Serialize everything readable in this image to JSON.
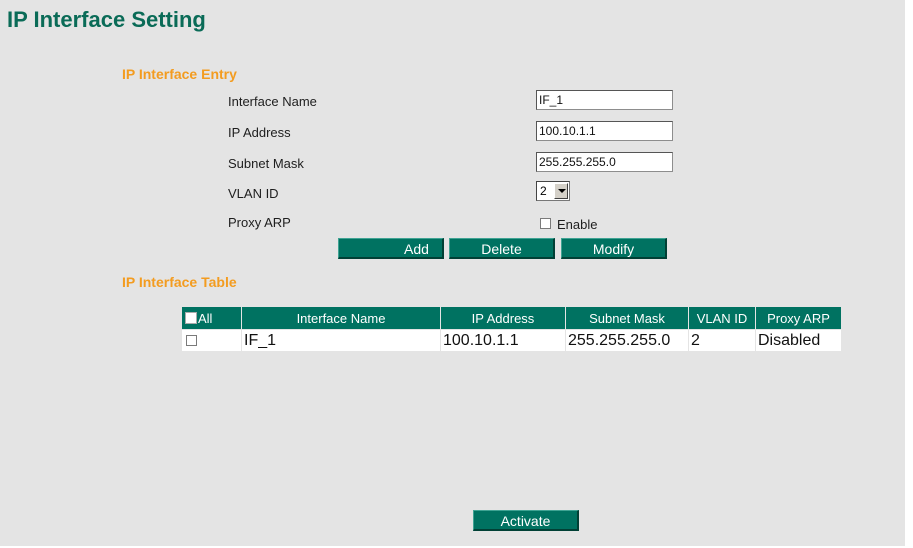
{
  "page": {
    "title": "IP Interface Setting"
  },
  "entry": {
    "heading": "IP Interface Entry",
    "interface_name": {
      "label": "Interface Name",
      "value": "IF_1"
    },
    "ip_address": {
      "label": "IP Address",
      "value": "100.10.1.1"
    },
    "subnet_mask": {
      "label": "Subnet Mask",
      "value": "255.255.255.0"
    },
    "vlan_id": {
      "label": "VLAN ID",
      "value": "2"
    },
    "proxy_arp": {
      "label": "Proxy ARP",
      "checkbox_label": "Enable",
      "checked": false
    },
    "buttons": {
      "add": "Add",
      "delete": "Delete",
      "modify": "Modify"
    }
  },
  "table": {
    "heading": "IP Interface Table",
    "columns": [
      "All",
      "Interface Name",
      "IP Address",
      "Subnet Mask",
      "VLAN ID",
      "Proxy ARP"
    ],
    "rows": [
      {
        "interface_name": "IF_1",
        "ip_address": "100.10.1.1",
        "subnet_mask": "255.255.255.0",
        "vlan_id": "2",
        "proxy_arp": "Disabled"
      }
    ]
  },
  "activate_label": "Activate",
  "colors": {
    "accent": "#007261",
    "heading": "#f39c20",
    "title": "#0a6b57",
    "background": "#e4e4e4"
  }
}
